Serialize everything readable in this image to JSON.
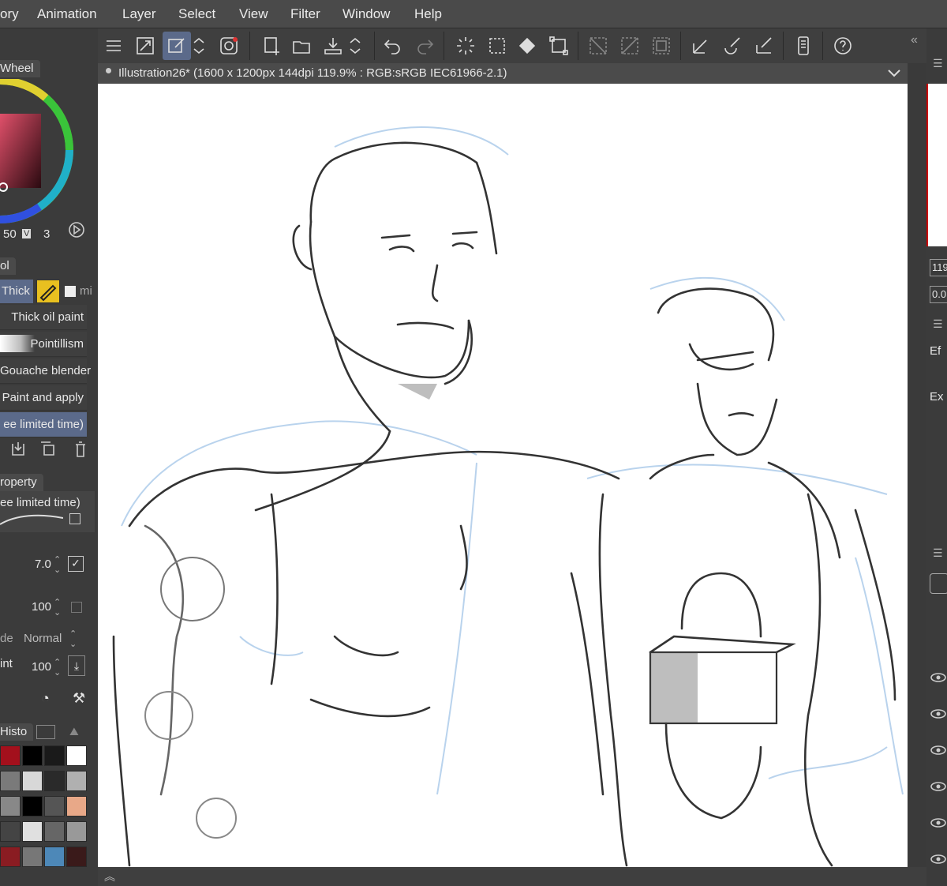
{
  "menu": [
    "ory",
    "Animation",
    "Layer",
    "Select",
    "View",
    "Filter",
    "Window",
    "Help"
  ],
  "canvas_tab": {
    "title": "Illustration26* (1600 x 1200px 144dpi 119.9% : RGB:sRGB IEC61966-2.1)"
  },
  "left_panel": {
    "color_wheel_tab": "Wheel",
    "color_values": {
      "s": "50",
      "v_label": "V",
      "v": "3"
    },
    "subtool_tab": "ol",
    "subtool_group": "Thick",
    "subtool_extra": "mi",
    "subtools": [
      "Thick oil paint",
      "Pointillism",
      "Gouache blender",
      "Paint and apply",
      "ee limited time)"
    ],
    "property_tab": "roperty",
    "property_name": "ee limited time)",
    "size_value": "7.0",
    "opacity_value": "100",
    "blend_label": "de",
    "blend_value": "Normal",
    "paint_label": "int",
    "paint_value": "100",
    "history_tab": "Histo"
  },
  "right_panel": {
    "zoom": "119",
    "angle": "0.0",
    "effect_label": "Ef",
    "expression_label": "Ex"
  },
  "swatches": [
    "#a3101c",
    "#000000",
    "#1a1a1a",
    "#ffffff",
    "#7a7a7a",
    "#d8d8d8",
    "#2a2a2a",
    "#b0b0b0",
    "#888888",
    "#000000",
    "#555555",
    "#e8a888",
    "#444444",
    "#e0e0e0",
    "#666666",
    "#999999",
    "#8a1c22",
    "#777777",
    "#4d88b8",
    "#3a1a1a"
  ],
  "icons": [
    "menu-icon",
    "resize-icon",
    "edit-icon",
    "updown-icon",
    "record-icon",
    "new-file-icon",
    "open-icon",
    "save-icon",
    "updown-icon",
    "undo-icon",
    "redo-icon",
    "loading-icon",
    "selection-icon",
    "fill-icon",
    "transform-icon",
    "deselect-icon",
    "invert-icon",
    "select-all-icon",
    "pen-icon",
    "brush-icon",
    "eraser-icon",
    "device-icon",
    "help-icon"
  ]
}
